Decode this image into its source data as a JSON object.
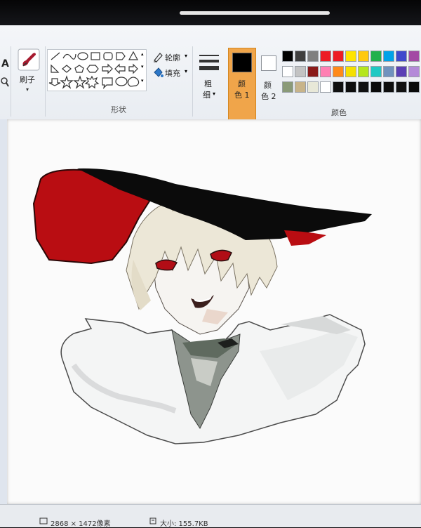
{
  "ribbon": {
    "brush_label": "刷子",
    "outline_label": "轮廓",
    "fill_label": "填充",
    "shapes_group_label": "形状",
    "size_label_1": "粗",
    "size_label_2": "细",
    "color1_label_1": "颜",
    "color1_label_2": "色 1",
    "color2_label_1": "颜",
    "color2_label_2": "色 2",
    "colors_group_label": "颜色"
  },
  "palette": {
    "row1": [
      "#000000",
      "#3f3f3f",
      "#7f7f7f",
      "#ed1c24",
      "#ed1c24",
      "#ffe400",
      "#ffc90e",
      "#22b14c",
      "#00a2e8",
      "#3f48cc",
      "#a349a4"
    ],
    "row2": [
      "#ffffff",
      "#c3c3c3",
      "#8a1a1a",
      "#ff7fb3",
      "#ff8a1a",
      "#f5e000",
      "#b5e61d",
      "#20c9c3",
      "#7092be",
      "#5a3fb5",
      "#b48ad8"
    ],
    "row3": [
      "#8a9a78",
      "#c8b48a",
      "#e8e8d8",
      "#ffffff",
      "#101010",
      "#0d0d0d",
      "#111111",
      "#0b0b0b",
      "#0e0e0e",
      "#111111",
      "#0a0a0a"
    ]
  },
  "active_colors": {
    "color1": "#000000",
    "color2": "#ffffff",
    "accent": "#f0a54a"
  },
  "icons": [
    "brush-icon",
    "outline-icon",
    "fill-icon",
    "line-size-icon"
  ],
  "status": {
    "dimensions": "2868 × 1472像素",
    "size": "大小: 155.7KB"
  }
}
